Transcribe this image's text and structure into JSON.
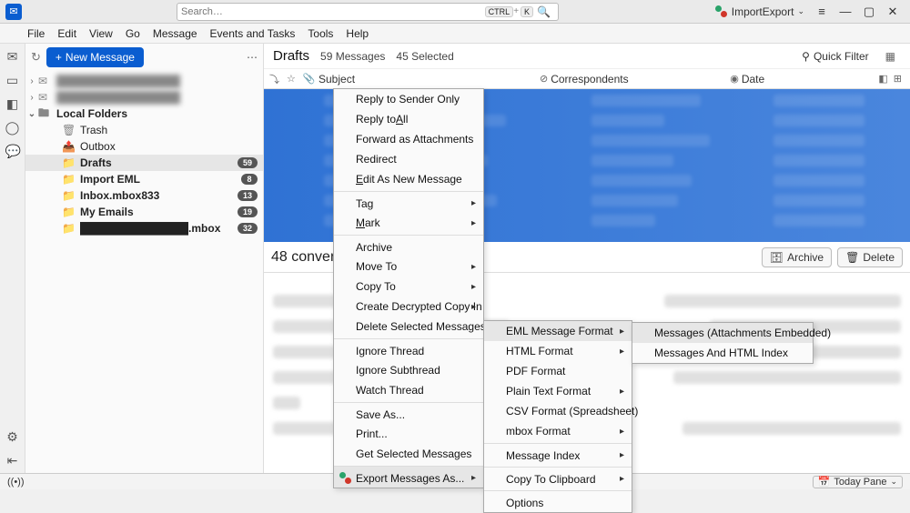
{
  "titlebar": {
    "search_placeholder": "Search…",
    "kbd1": "CTRL",
    "kbd2": "K",
    "import_export": "ImportExport"
  },
  "menubar": [
    "File",
    "Edit",
    "View",
    "Go",
    "Message",
    "Events and Tasks",
    "Tools",
    "Help"
  ],
  "sidebar": {
    "new_msg": "New Message",
    "accounts": [
      {
        "label": "████████████████"
      },
      {
        "label": "████████████████"
      }
    ],
    "local_label": "Local Folders",
    "items": [
      {
        "icon": "🗑",
        "label": "Trash",
        "bold": false,
        "badge": ""
      },
      {
        "icon": "📤",
        "label": "Outbox",
        "bold": false,
        "badge": ""
      },
      {
        "icon": "📁",
        "label": "Drafts",
        "bold": true,
        "badge": "59",
        "selected": true
      },
      {
        "icon": "📁",
        "label": "Import EML",
        "bold": true,
        "badge": "8"
      },
      {
        "icon": "📁",
        "label": "Inbox.mbox833",
        "bold": true,
        "badge": "13"
      },
      {
        "icon": "📁",
        "label": "My Emails",
        "bold": true,
        "badge": "19"
      },
      {
        "icon": "📁",
        "label": "██████████████.mbox",
        "bold": true,
        "badge": "32"
      }
    ]
  },
  "content": {
    "title": "Drafts",
    "count": "59 Messages",
    "selected": "45 Selected",
    "quick_filter": "Quick Filter",
    "columns": {
      "subject": "Subject",
      "correspondents": "Correspondents",
      "date": "Date"
    },
    "conv_title": "48 conver",
    "archive": "Archive",
    "delete": "Delete"
  },
  "ctx1": [
    {
      "label": "Reply to Sender Only"
    },
    {
      "label_pre": "Reply to ",
      "label_u": "A",
      "label_post": "ll"
    },
    {
      "label": "Forward as Attachments"
    },
    {
      "label": "Redirect"
    },
    {
      "label_u": "E",
      "label_post": "dit As New Message"
    },
    {
      "sep": true,
      "label": "Tag",
      "sub": true
    },
    {
      "label_u": "M",
      "label_post": "ark",
      "sub": true
    },
    {
      "sep": true,
      "label": "Archive"
    },
    {
      "label": "Move To",
      "sub": true
    },
    {
      "label": "Copy To",
      "sub": true
    },
    {
      "label": "Create Decrypted Copy In",
      "sub": true
    },
    {
      "label": "Delete Selected Messages"
    },
    {
      "sep": true,
      "label": "Ignore Thread"
    },
    {
      "label": "Ignore Subthread"
    },
    {
      "label": "Watch Thread"
    },
    {
      "sep": true,
      "label": "Save As..."
    },
    {
      "label": "Print..."
    },
    {
      "label": "Get Selected Messages"
    },
    {
      "sep": true,
      "label": "Export Messages As...",
      "sub": true,
      "hi": true,
      "icon": "ie"
    }
  ],
  "ctx2": [
    {
      "label": "EML Message Format",
      "sub": true,
      "hi": true
    },
    {
      "label": "HTML Format",
      "sub": true
    },
    {
      "label": "PDF Format"
    },
    {
      "label": "Plain Text Format",
      "sub": true
    },
    {
      "label": "CSV Format (Spreadsheet)"
    },
    {
      "label": "mbox Format",
      "sub": true
    },
    {
      "sep": true,
      "label": "Message Index",
      "sub": true
    },
    {
      "sep": true,
      "label": "Copy To Clipboard",
      "sub": true
    },
    {
      "sep": true,
      "label": "Options"
    }
  ],
  "ctx3": [
    {
      "label": "Messages (Attachments Embedded)",
      "hi": true
    },
    {
      "label": "Messages And HTML Index"
    }
  ],
  "statusbar": {
    "sync": "((•))",
    "today": "Today Pane"
  }
}
